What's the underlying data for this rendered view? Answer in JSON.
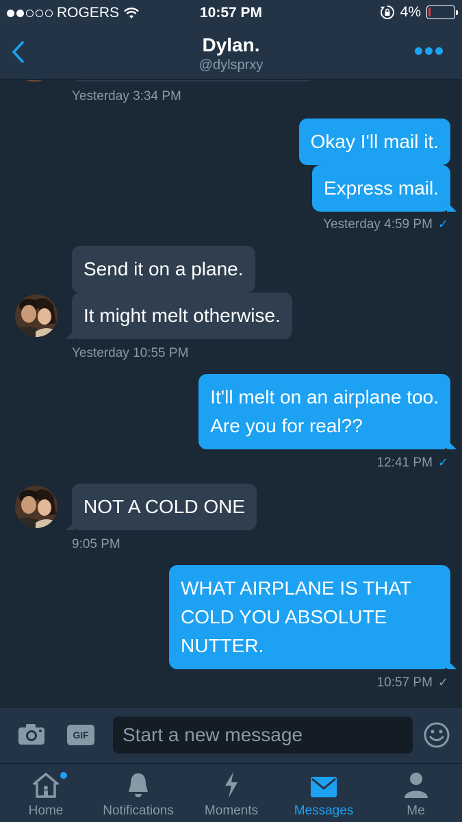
{
  "status_bar": {
    "carrier": "ROGERS",
    "time": "10:57 PM",
    "battery": "4%",
    "battery_level": 0.04,
    "icons": [
      "signal-dots-icon",
      "wifi-icon",
      "rotation-lock-icon",
      "battery-icon"
    ]
  },
  "header": {
    "name": "Dylan.",
    "handle": "@dylsprxy",
    "back_icon": "chevron-left-icon",
    "more_icon": "more-dots-icon"
  },
  "messages": [
    {
      "type": "timestamp",
      "text": "Yesterday 3:34 PM"
    },
    {
      "type": "sent",
      "text": "Okay I'll mail it."
    },
    {
      "type": "sent",
      "text": "Express mail."
    },
    {
      "type": "timestamp",
      "text": "Yesterday 4:59 PM",
      "read": true
    },
    {
      "type": "received",
      "text": "Send it on a plane."
    },
    {
      "type": "received",
      "text": "It might melt otherwise."
    },
    {
      "type": "timestamp",
      "text": "Yesterday 10:55 PM"
    },
    {
      "type": "sent",
      "lines": [
        "It'll melt on an airplane too.",
        "Are you for real??"
      ]
    },
    {
      "type": "timestamp",
      "text": "12:41 PM",
      "read": true
    },
    {
      "type": "received",
      "text": "NOT A COLD ONE"
    },
    {
      "type": "timestamp",
      "text": "9:05 PM"
    },
    {
      "type": "sent",
      "lines": [
        "WHAT AIRPLANE IS THAT",
        "COLD YOU ABSOLUTE",
        "NUTTER."
      ]
    },
    {
      "type": "timestamp",
      "text": "10:57 PM",
      "read": false
    }
  ],
  "check_mark": "✓",
  "composer": {
    "placeholder": "Start a new message",
    "gif_label": "GIF",
    "camera_icon": "camera-icon",
    "emoji_icon": "smiley-icon"
  },
  "tabs": [
    {
      "label": "Home",
      "icon": "home-icon",
      "active": false,
      "badge": true
    },
    {
      "label": "Notifications",
      "icon": "bell-icon",
      "active": false
    },
    {
      "label": "Moments",
      "icon": "lightning-icon",
      "active": false
    },
    {
      "label": "Messages",
      "icon": "envelope-icon",
      "active": true
    },
    {
      "label": "Me",
      "icon": "person-icon",
      "active": false
    }
  ],
  "colors": {
    "background": "#1b2836",
    "bar": "#243447",
    "sent_bubble": "#1da1f2",
    "received_bubble": "#2f3f50",
    "muted_text": "#8899a6",
    "accent": "#1da1f2"
  }
}
